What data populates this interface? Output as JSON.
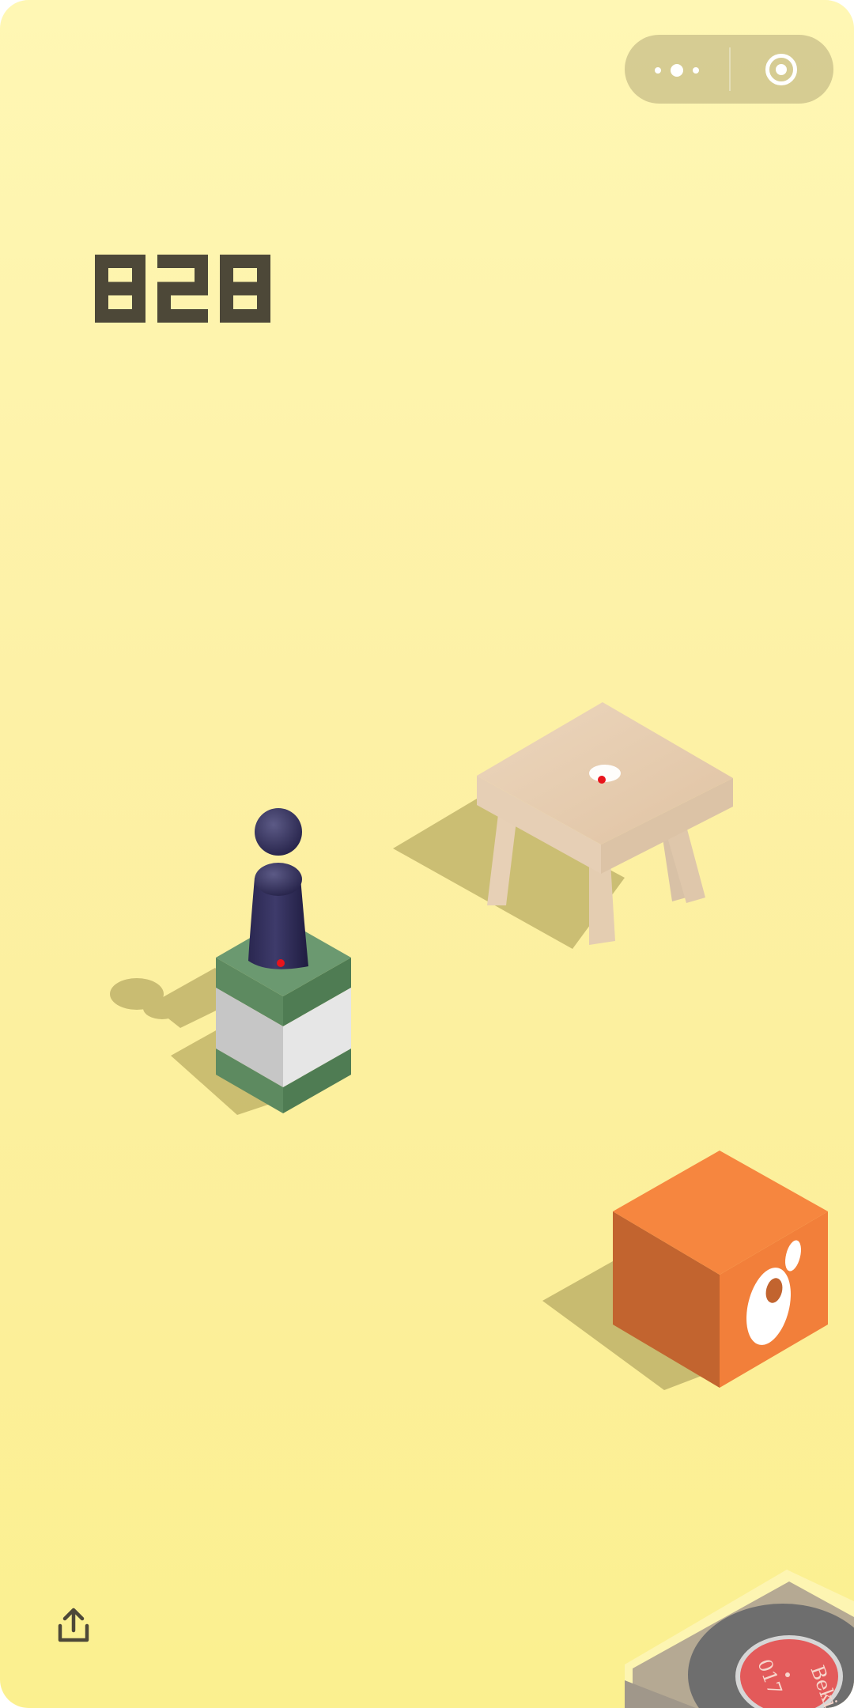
{
  "score": {
    "value": "828",
    "color": "#4d4838"
  },
  "capsule": {
    "more_icon": "more-dots-icon",
    "close_icon": "target-circle-icon"
  },
  "share": {
    "icon": "share-upload-icon"
  },
  "colors": {
    "background_top": "#fff7b4",
    "background_bottom": "#fbf08f",
    "platform_green": "#5b8a5f",
    "platform_white": "#e6e6e6",
    "orange_cube": "#f27f3a",
    "stool_wood": "#e8d0b4",
    "player": "#2b2850",
    "record_red": "#e35a5a"
  },
  "record_label": {
    "line1": "Beki",
    "line2": "017"
  }
}
